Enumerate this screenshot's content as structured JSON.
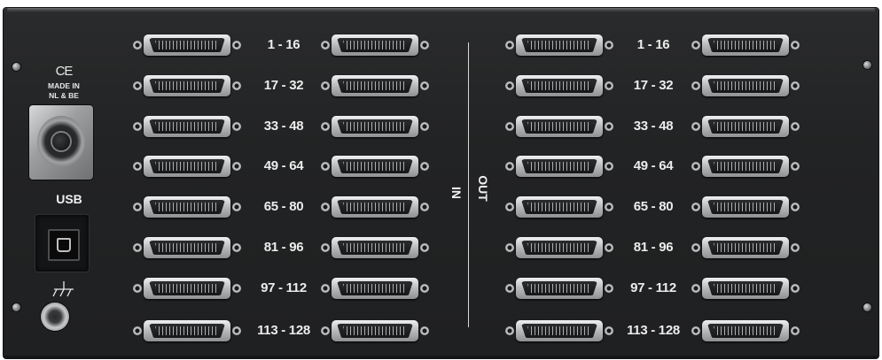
{
  "left_panel": {
    "ce_mark": "CE",
    "made_in_line1": "MADE IN",
    "made_in_line2": "NL & BE",
    "usb_label": "USB"
  },
  "io_labels": {
    "in": "IN",
    "out": "OUT"
  },
  "ranges": [
    "1 - 16",
    "17 - 32",
    "33 - 48",
    "49 - 64",
    "65 - 80",
    "81 - 96",
    "97 - 112",
    "113 - 128"
  ],
  "icons": [
    "power-connector-icon",
    "usb-b-port-icon",
    "ground-symbol-icon",
    "ground-post-icon",
    "screw-icon",
    "dsub-connector-icon"
  ],
  "colors": {
    "panel": "#232425",
    "text": "#ececec",
    "connector": "#b7b9bb"
  }
}
